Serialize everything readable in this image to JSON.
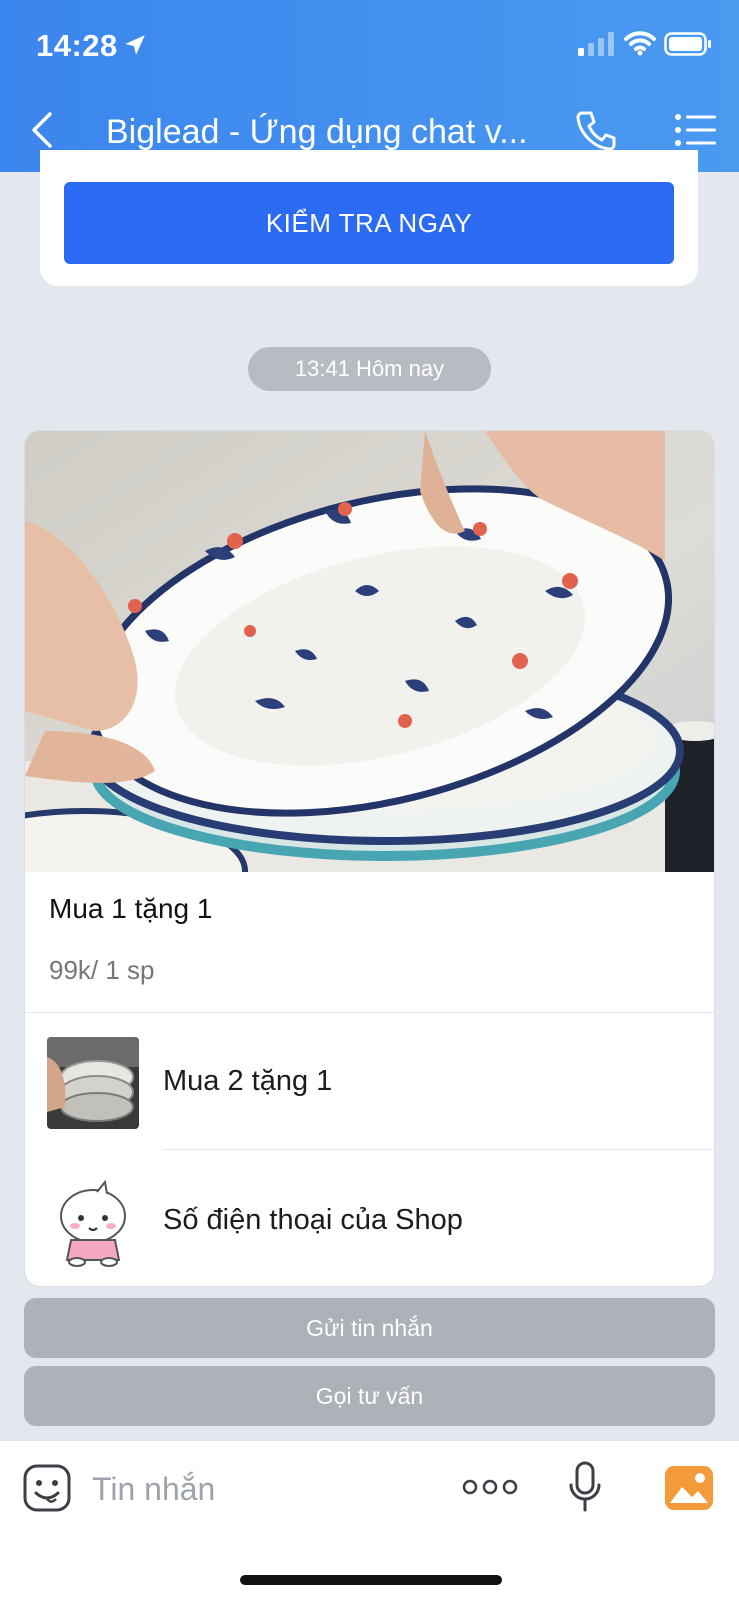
{
  "status_bar": {
    "time": "14:28"
  },
  "header": {
    "title": "Biglead - Ứng dụng chat v..."
  },
  "top_card": {
    "button_label": "KIỂM TRA NGAY"
  },
  "timestamp": "13:41 Hôm nay",
  "product": {
    "title": "Mua 1 tặng 1",
    "price": "99k/ 1 sp",
    "options": [
      {
        "label": "Mua 2 tặng 1",
        "icon": "bowls-thumbnail"
      },
      {
        "label": "Số điện thoại của Shop",
        "icon": "bunny-sticker"
      }
    ]
  },
  "actions": {
    "send_message": "Gửi tin nhắn",
    "call_advice": "Gọi tư vấn"
  },
  "input": {
    "placeholder": "Tin nhắn"
  },
  "colors": {
    "header": "#3b85ee",
    "primary_button": "#2b6bf3",
    "action_button": "#adb1b8",
    "image_icon": "#f39a3a"
  }
}
